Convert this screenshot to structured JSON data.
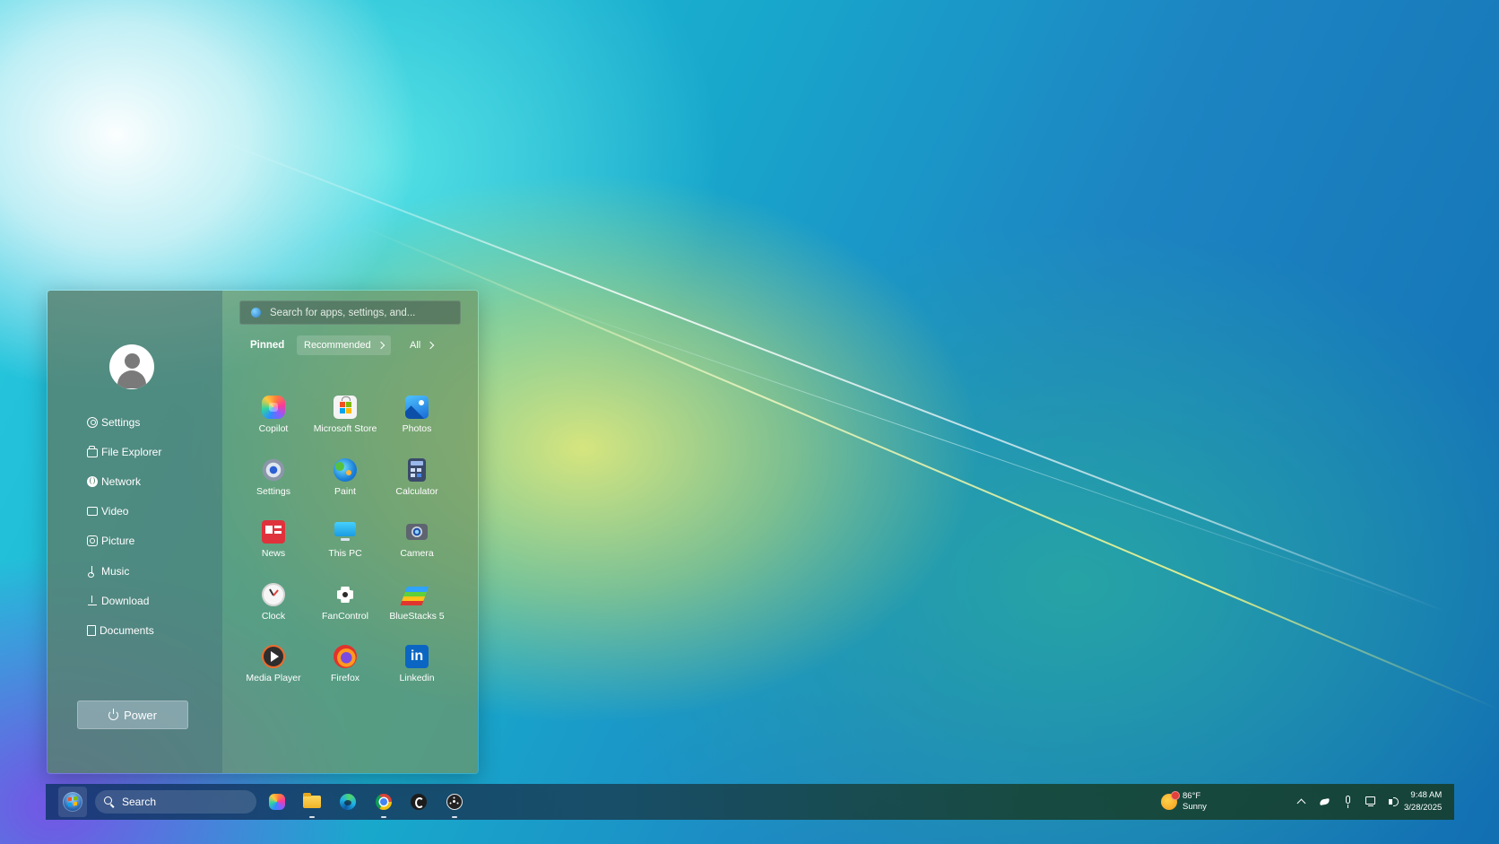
{
  "start_menu": {
    "user_avatar": "user-icon",
    "nav_items": [
      {
        "label": "Settings",
        "icon": "gear-icon"
      },
      {
        "label": "File Explorer",
        "icon": "folder-icon"
      },
      {
        "label": "Network",
        "icon": "globe-icon"
      },
      {
        "label": "Video",
        "icon": "video-icon"
      },
      {
        "label": "Picture",
        "icon": "picture-icon"
      },
      {
        "label": "Music",
        "icon": "music-note-icon"
      },
      {
        "label": "Download",
        "icon": "download-icon"
      },
      {
        "label": "Documents",
        "icon": "document-icon"
      }
    ],
    "power_label": "Power",
    "search_placeholder": "Search for apps, settings, and...",
    "tabs": {
      "pinned": "Pinned",
      "recommended": "Recommended",
      "all": "All"
    },
    "apps": [
      {
        "label": "Copilot",
        "icon": "copilot-icon"
      },
      {
        "label": "Microsoft Store",
        "icon": "microsoft-store-icon"
      },
      {
        "label": "Photos",
        "icon": "photos-icon"
      },
      {
        "label": "Settings",
        "icon": "settings-icon"
      },
      {
        "label": "Paint",
        "icon": "paint-icon"
      },
      {
        "label": "Calculator",
        "icon": "calculator-icon"
      },
      {
        "label": "News",
        "icon": "news-icon"
      },
      {
        "label": "This PC",
        "icon": "this-pc-icon"
      },
      {
        "label": "Camera",
        "icon": "camera-icon"
      },
      {
        "label": "Clock",
        "icon": "clock-icon"
      },
      {
        "label": "FanControl",
        "icon": "fan-icon"
      },
      {
        "label": "BlueStacks 5",
        "icon": "bluestacks-icon"
      },
      {
        "label": "Media Player",
        "icon": "media-player-icon"
      },
      {
        "label": "Firefox",
        "icon": "firefox-icon"
      },
      {
        "label": "Linkedin",
        "icon": "linkedin-icon",
        "glyph": "in"
      }
    ]
  },
  "taskbar": {
    "search_label": "Search",
    "apps": [
      "copilot-icon",
      "file-explorer-icon",
      "edge-icon",
      "chrome-icon",
      "app-icon",
      "fan-control-icon"
    ],
    "weather": {
      "temperature": "86°F",
      "condition": "Sunny"
    },
    "tray_icons": [
      "chevron-up-icon",
      "bird-icon",
      "microphone-icon",
      "network-icon",
      "volume-icon"
    ],
    "clock": {
      "time": "9:48 AM",
      "date": "3/28/2025"
    }
  },
  "colors": {
    "accent": "#1e5aa8",
    "start_left_pane": "#58806e",
    "start_right_pane": "#70966e",
    "linkedin": "#0a66c2"
  }
}
